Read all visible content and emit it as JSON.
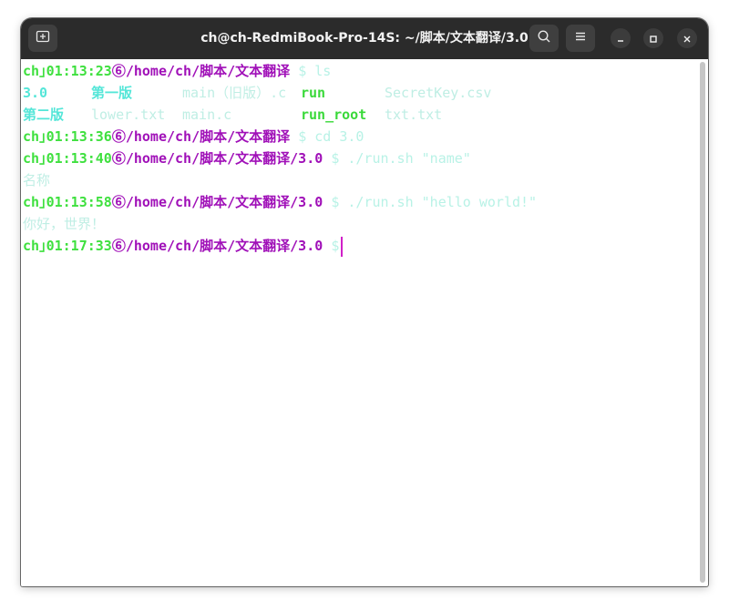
{
  "window": {
    "title": "ch@ch-RedmiBook-Pro-14S: ~/脚本/文本翻译/3.0",
    "new_tab_icon": "new-tab-icon",
    "search_icon": "search-icon",
    "menu_icon": "hamburger-menu-icon",
    "minimize_icon": "minimize-icon",
    "maximize_icon": "maximize-icon",
    "close_icon": "close-icon"
  },
  "colors": {
    "user": "#3fe03f",
    "path": "#a010b8",
    "directory": "#54e6d8",
    "executable": "#3ad93a",
    "command": "#b8f2e6",
    "cursor": "#d020c8"
  },
  "terminal": {
    "prompts": [
      {
        "user": "ch",
        "time": "01:13:23",
        "path": "/home/ch/脚本/文本翻译",
        "command": "$ ls"
      },
      {
        "user": "ch",
        "time": "01:13:36",
        "path": "/home/ch/脚本/文本翻译",
        "command": "$ cd 3.0"
      },
      {
        "user": "ch",
        "time": "01:13:40",
        "path": "/home/ch/脚本/文本翻译/3.0",
        "command": "$ ./run.sh \"name\""
      },
      {
        "user": "ch",
        "time": "01:13:58",
        "path": "/home/ch/脚本/文本翻译/3.0",
        "command": "$ ./run.sh \"hello world!\""
      },
      {
        "user": "ch",
        "time": "01:17:33",
        "path": "/home/ch/脚本/文本翻译/3.0",
        "command": "$"
      }
    ],
    "ls_output": {
      "row1": [
        "3.0",
        "第一版",
        "main（旧版）.c",
        "run",
        "SecretKey.csv"
      ],
      "row2": [
        "第二版",
        "lower.txt",
        "main.c",
        "run_root",
        "txt.txt"
      ]
    },
    "outputs": [
      "名称",
      "你好，世界！"
    ]
  }
}
